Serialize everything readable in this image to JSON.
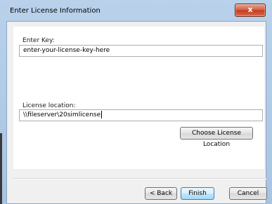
{
  "window": {
    "title": "Enter License Information",
    "close_glyph": "x"
  },
  "key": {
    "label": "Enter Key:",
    "value": "enter-your-license-key-here"
  },
  "location": {
    "label": "License location:",
    "value": "\\\\fileserver\\20simlicense",
    "choose_button": "Choose License Location"
  },
  "buttons": {
    "back": "< Back",
    "finish": "Finish",
    "cancel": "Cancel"
  },
  "colors": {
    "title_gradient_top": "#b9d1ea",
    "close_button": "#c33a1f",
    "default_button_border": "#3c7fb1"
  }
}
